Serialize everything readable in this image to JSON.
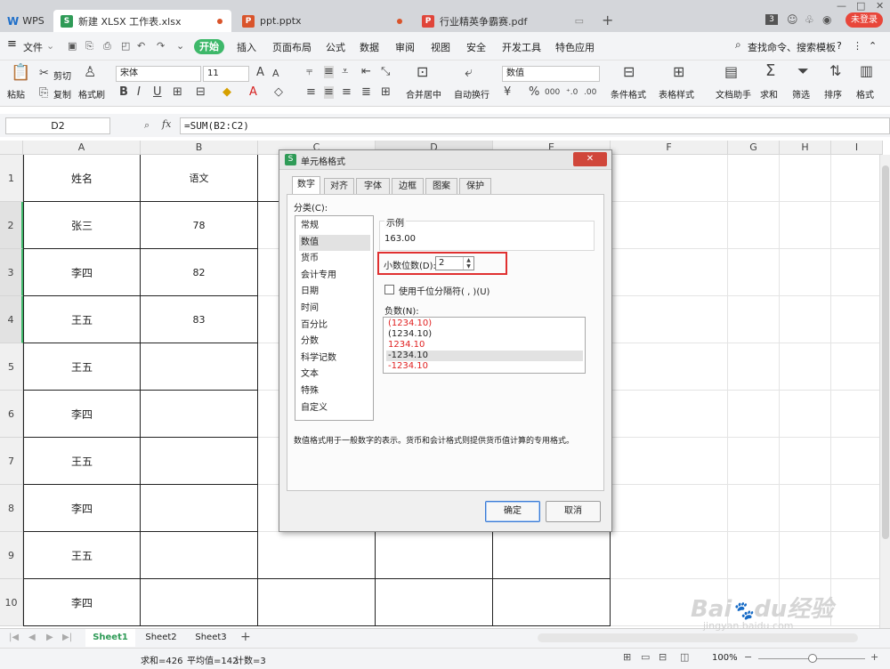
{
  "tabs": {
    "wps": "WPS",
    "xlsx": "新建 XLSX 工作表.xlsx",
    "ppt": "ppt.pptx",
    "pdf": "行业精英争霸赛.pdf",
    "login": "未登录"
  },
  "menu": [
    "文件",
    "开始",
    "插入",
    "页面布局",
    "公式",
    "数据",
    "审阅",
    "视图",
    "安全",
    "开发工具",
    "特色应用"
  ],
  "search": "查找命令、搜索模板",
  "ribbon": {
    "paste": "粘贴",
    "cut": "剪切",
    "copy": "复制",
    "format_painter": "格式刷",
    "font_name": "宋体",
    "font_size": "11",
    "merge": "合并居中",
    "wrap": "自动换行",
    "number_format": "数值",
    "cond_format": "条件格式",
    "table_style": "表格样式",
    "doc_helper": "文档助手",
    "sum": "求和",
    "filter": "筛选",
    "sort": "排序",
    "format": "格式"
  },
  "formula_bar": {
    "cell_ref": "D2",
    "fx": "fx",
    "formula": "=SUM(B2:C2)"
  },
  "grid": {
    "columns": [
      "A",
      "B",
      "C",
      "D",
      "E",
      "F",
      "G",
      "H",
      "I"
    ],
    "rows": [
      "1",
      "2",
      "3",
      "4",
      "5",
      "6",
      "7",
      "8",
      "9",
      "10"
    ],
    "colA": [
      "姓名",
      "张三",
      "李四",
      "王五",
      "王五",
      "李四",
      "王五",
      "李四",
      "王五",
      "李四"
    ],
    "colB": [
      "语文",
      "78",
      "82",
      "83",
      "",
      "",
      "",
      "",
      "",
      ""
    ]
  },
  "sheets": [
    "Sheet1",
    "Sheet2",
    "Sheet3"
  ],
  "status": {
    "sum": "求和=426",
    "avg": "平均值=142",
    "count": "计数=3",
    "zoom": "100%"
  },
  "dialog": {
    "title": "单元格格式",
    "tabs": [
      "数字",
      "对齐",
      "字体",
      "边框",
      "图案",
      "保护"
    ],
    "category_label": "分类(C):",
    "categories": [
      "常规",
      "数值",
      "货币",
      "会计专用",
      "日期",
      "时间",
      "百分比",
      "分数",
      "科学记数",
      "文本",
      "特殊",
      "自定义"
    ],
    "sample_label": "示例",
    "sample_value": "163.00",
    "decimal_label": "小数位数(D):",
    "decimal_value": "2",
    "thousands_label": "使用千位分隔符( , )(U)",
    "negative_label": "负数(N):",
    "negatives": [
      "(1234.10)",
      "(1234.10)",
      "1234.10",
      "-1234.10",
      "-1234.10"
    ],
    "description": "数值格式用于一般数字的表示。货币和会计格式则提供货币值计算的专用格式。",
    "ok": "确定",
    "cancel": "取消"
  },
  "colors": {
    "accent_green": "#3eb86a",
    "negative_red": "#e02020",
    "highlight_red": "#e03030",
    "login_badge": "#e8463a"
  },
  "watermark": {
    "logo": "Baidu经验",
    "url": "jingyan.baidu.com"
  }
}
